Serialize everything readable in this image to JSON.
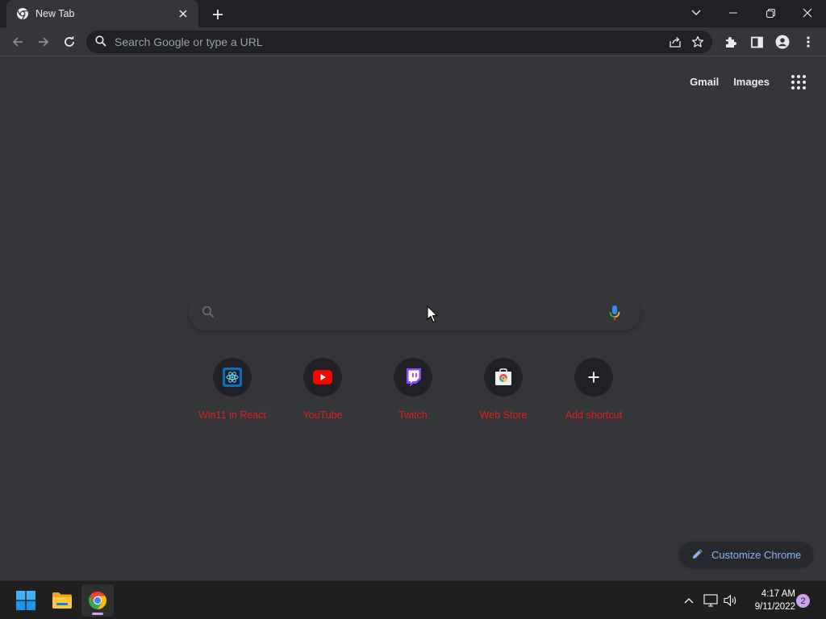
{
  "browser": {
    "tab": {
      "title": "New Tab",
      "favicon": "chrome-icon",
      "close_icon": "close-icon"
    },
    "new_tab_icon": "plus-icon",
    "window_controls": [
      "tab-search-icon",
      "minimize-icon",
      "restore-icon",
      "close-icon"
    ]
  },
  "toolbar": {
    "back_icon": "arrow-left-icon",
    "forward_icon": "arrow-right-icon",
    "reload_icon": "reload-icon",
    "omnibox_placeholder": "Search Google or type a URL",
    "omnibox_actions": [
      "share-icon",
      "star-icon"
    ],
    "right_icons": [
      "extensions-icon",
      "side-panel-icon",
      "profile-icon",
      "more-vert-icon"
    ]
  },
  "ntp": {
    "links": {
      "gmail": "Gmail",
      "images": "Images"
    },
    "apps_icon": "apps-grid-icon",
    "search": {
      "value": "",
      "placeholder": "",
      "mic_icon": "mic-icon"
    },
    "shortcuts": [
      {
        "label": "Win11 in React",
        "icon": "react-logo-icon"
      },
      {
        "label": "YouTube",
        "icon": "youtube-icon"
      },
      {
        "label": "Twitch",
        "icon": "twitch-icon"
      },
      {
        "label": "Web Store",
        "icon": "web-store-icon"
      },
      {
        "label": "Add shortcut",
        "icon": "plus-icon"
      }
    ],
    "customize_label": "Customize Chrome"
  },
  "taskbar": {
    "apps": [
      {
        "name": "Start",
        "icon": "windows-logo-icon"
      },
      {
        "name": "File Explorer",
        "icon": "folder-icon"
      },
      {
        "name": "Google Chrome",
        "icon": "chrome-icon",
        "active": true
      }
    ],
    "tray_icons": [
      "chevron-up-icon",
      "network-icon",
      "volume-icon"
    ],
    "clock": {
      "time": "4:17 AM",
      "date": "9/11/2022"
    },
    "notification_count": "2"
  },
  "colors": {
    "titlebar": "#202124",
    "toolbar": "#35363a",
    "page_bg": "#35363a",
    "shortcut_label": "#e02020",
    "accent_link": "#8ab4f8",
    "taskbar": "#1f1f1f",
    "notification_badge": "#c9a4e8"
  }
}
